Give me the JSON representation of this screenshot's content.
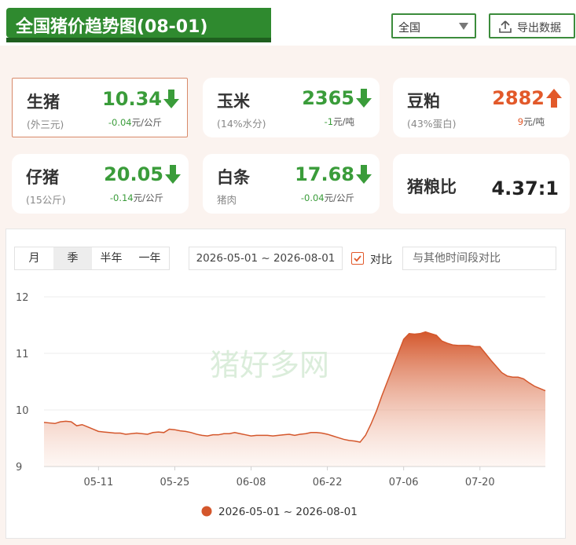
{
  "header": {
    "title": "全国猪价趋势图(08-01)",
    "region": "全国",
    "export_label": "导出数据"
  },
  "cards": [
    {
      "name": "生猪",
      "sub": "(外三元)",
      "price": "10.34",
      "change": "-0.04",
      "unit": "元/公斤",
      "trend": "down"
    },
    {
      "name": "玉米",
      "sub": "(14%水分)",
      "price": "2365",
      "change": "-1",
      "unit": "元/吨",
      "trend": "down"
    },
    {
      "name": "豆粕",
      "sub": "(43%蛋白)",
      "price": "2882",
      "change": "9",
      "unit": "元/吨",
      "trend": "up"
    },
    {
      "name": "仔猪",
      "sub": "(15公斤)",
      "price": "20.05",
      "change": "-0.14",
      "unit": "元/公斤",
      "trend": "down"
    },
    {
      "name": "白条",
      "sub": "猪肉",
      "price": "17.68",
      "change": "-0.04",
      "unit": "元/公斤",
      "trend": "down"
    },
    {
      "name": "猪粮比",
      "ratio": "4.37:1"
    }
  ],
  "controls": {
    "ranges": [
      "月",
      "季",
      "半年",
      "一年"
    ],
    "active_range": "季",
    "date_range": "2026-05-01 ~ 2026-08-01",
    "compare_label": "对比",
    "compare_placeholder": "与其他时间段对比"
  },
  "colors": {
    "brand_green": "#2f8a2f",
    "down_green": "#3a9c3a",
    "up_orange": "#e2592a",
    "series": "#d4572c"
  },
  "chart_data": {
    "type": "area",
    "title": "",
    "xlabel": "",
    "ylabel": "",
    "ylim": [
      9,
      12
    ],
    "yticks": [
      9,
      10,
      11,
      12
    ],
    "xticks": [
      "05-11",
      "05-25",
      "06-08",
      "06-22",
      "07-06",
      "07-20"
    ],
    "grid": true,
    "legend": "bottom-center",
    "watermark": "猪好多网",
    "series": [
      {
        "name": "2026-05-01 ~ 2026-08-01",
        "x": [
          "05-01",
          "05-02",
          "05-03",
          "05-04",
          "05-05",
          "05-06",
          "05-07",
          "05-08",
          "05-09",
          "05-10",
          "05-11",
          "05-12",
          "05-13",
          "05-14",
          "05-15",
          "05-16",
          "05-17",
          "05-18",
          "05-19",
          "05-20",
          "05-21",
          "05-22",
          "05-23",
          "05-24",
          "05-25",
          "05-26",
          "05-27",
          "05-28",
          "05-29",
          "05-30",
          "05-31",
          "06-01",
          "06-02",
          "06-03",
          "06-04",
          "06-05",
          "06-06",
          "06-07",
          "06-08",
          "06-09",
          "06-10",
          "06-11",
          "06-12",
          "06-13",
          "06-14",
          "06-15",
          "06-16",
          "06-17",
          "06-18",
          "06-19",
          "06-20",
          "06-21",
          "06-22",
          "06-23",
          "06-24",
          "06-25",
          "06-26",
          "06-27",
          "06-28",
          "06-29",
          "06-30",
          "07-01",
          "07-02",
          "07-03",
          "07-04",
          "07-05",
          "07-06",
          "07-07",
          "07-08",
          "07-09",
          "07-10",
          "07-11",
          "07-12",
          "07-13",
          "07-14",
          "07-15",
          "07-16",
          "07-17",
          "07-18",
          "07-19",
          "07-20",
          "07-21",
          "07-22",
          "07-23",
          "07-24",
          "07-25",
          "07-26",
          "07-27",
          "07-28",
          "07-29",
          "07-30",
          "07-31",
          "08-01"
        ],
        "values": [
          9.78,
          9.77,
          9.76,
          9.79,
          9.8,
          9.79,
          9.72,
          9.74,
          9.7,
          9.66,
          9.62,
          9.61,
          9.6,
          9.59,
          9.59,
          9.57,
          9.58,
          9.59,
          9.58,
          9.57,
          9.6,
          9.61,
          9.6,
          9.66,
          9.65,
          9.63,
          9.62,
          9.6,
          9.57,
          9.55,
          9.54,
          9.56,
          9.56,
          9.58,
          9.58,
          9.6,
          9.58,
          9.56,
          9.54,
          9.55,
          9.55,
          9.55,
          9.54,
          9.55,
          9.56,
          9.57,
          9.55,
          9.57,
          9.58,
          9.6,
          9.6,
          9.59,
          9.57,
          9.54,
          9.51,
          9.48,
          9.46,
          9.45,
          9.43,
          9.55,
          9.75,
          9.98,
          10.25,
          10.5,
          10.75,
          11.0,
          11.25,
          11.35,
          11.34,
          11.35,
          11.38,
          11.35,
          11.32,
          11.22,
          11.18,
          11.15,
          11.14,
          11.14,
          11.14,
          11.12,
          11.12,
          11.0,
          10.88,
          10.77,
          10.66,
          10.6,
          10.58,
          10.58,
          10.55,
          10.48,
          10.42,
          10.38,
          10.34
        ]
      }
    ]
  }
}
